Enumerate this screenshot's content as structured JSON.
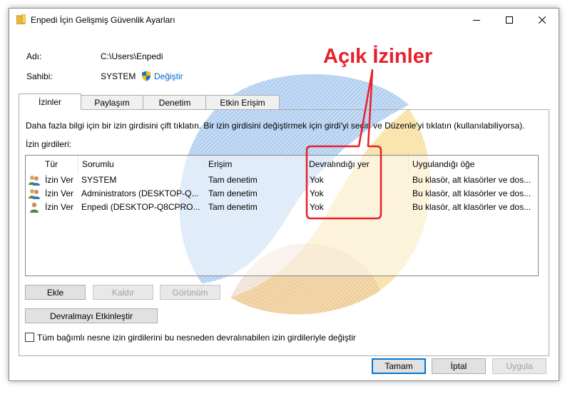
{
  "window": {
    "title": "Enpedi İçin Gelişmiş Güvenlik Ayarları"
  },
  "info": {
    "name_label": "Adı:",
    "name_value": "C:\\Users\\Enpedi",
    "owner_label": "Sahibi:",
    "owner_value": "SYSTEM",
    "change_link": "Değiştir"
  },
  "tabs": [
    {
      "label": "İzinler",
      "active": true
    },
    {
      "label": "Paylaşım",
      "active": false
    },
    {
      "label": "Denetim",
      "active": false
    },
    {
      "label": "Etkin Erişim",
      "active": false
    }
  ],
  "description": "Daha fazla bilgi için bir izin girdisini çift tıklatın. Bir izin girdisini değiştirmek için girdi'yi seçin ve Düzenle'yi tıklatın (kullanılabiliyorsa).",
  "entries_label": "İzin girdileri:",
  "table": {
    "columns": [
      "Tür",
      "Sorumlu",
      "Erişim",
      "Devralındığı yer",
      "Uygulandığı öğe"
    ],
    "rows": [
      {
        "icon": "user-group-icon",
        "type": "İzin Ver",
        "principal": "SYSTEM",
        "access": "Tam denetim",
        "inherited": "Yok",
        "applies": "Bu klasör, alt klasörler ve dos..."
      },
      {
        "icon": "user-group-icon",
        "type": "İzin Ver",
        "principal": "Administrators (DESKTOP-Q...",
        "access": "Tam denetim",
        "inherited": "Yok",
        "applies": "Bu klasör, alt klasörler ve dos..."
      },
      {
        "icon": "user-icon",
        "type": "İzin Ver",
        "principal": "Enpedi (DESKTOP-Q8CPRO...",
        "access": "Tam denetim",
        "inherited": "Yok",
        "applies": "Bu klasör, alt klasörler ve dos..."
      }
    ]
  },
  "buttons": {
    "add": "Ekle",
    "remove": "Kaldır",
    "view": "Görünüm",
    "enable_inheritance": "Devralmayı Etkinleştir",
    "ok": "Tamam",
    "cancel": "İptal",
    "apply": "Uygula"
  },
  "replace_checkbox": {
    "label": "Tüm bağımlı nesne izin girdilerini bu nesneden devralınabilen izin girdileriyle değiştir",
    "checked": false
  },
  "annotation": {
    "text": "Açık İzinler",
    "color": "#e8202a"
  },
  "colors": {
    "link": "#0066cc",
    "default_button_border": "#0078d7",
    "shield_blue": "#1f6fd1",
    "shield_yellow": "#f2c200"
  }
}
